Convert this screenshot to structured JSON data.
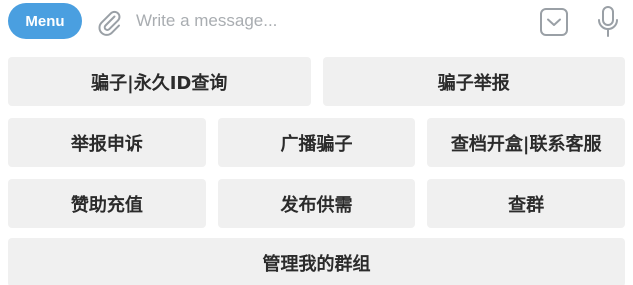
{
  "composer": {
    "menu_label": "Menu",
    "placeholder": "Write a message...",
    "icons": {
      "attach": "paperclip-icon",
      "keyboard_toggle": "chevron-down-square-icon",
      "voice": "microphone-icon"
    }
  },
  "keyboard": {
    "rows": [
      [
        "骗子|永久ID查询",
        "骗子举报"
      ],
      [
        "举报申诉",
        "广播骗子",
        "查档开盒|联系客服"
      ],
      [
        "赞助充值",
        "发布供需",
        "查群"
      ],
      [
        "管理我的群组"
      ]
    ]
  },
  "colors": {
    "menu_button": "#4a9fe0",
    "key_background": "#f0f0f0",
    "icon_gray": "#9aa0a6"
  }
}
